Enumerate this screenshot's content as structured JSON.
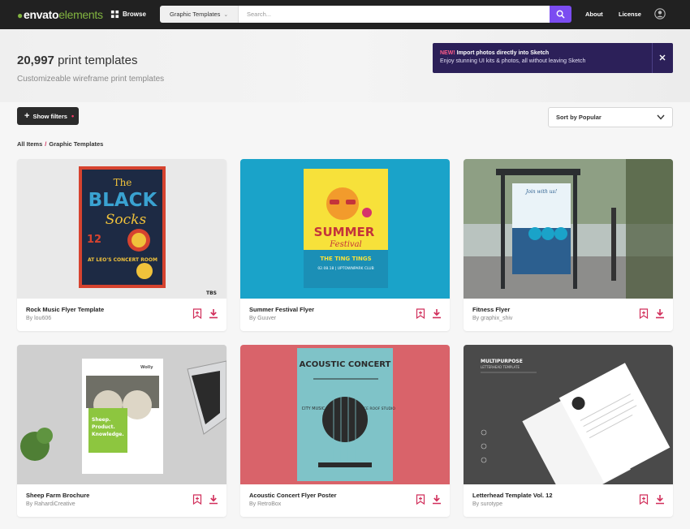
{
  "brand": {
    "logo_main": "envato",
    "logo_accent": "elements"
  },
  "nav": {
    "browse_label": "Browse",
    "category_select": "Graphic Templates",
    "search_placeholder": "Search...",
    "about_label": "About",
    "license_label": "License"
  },
  "header": {
    "count": "20,997",
    "title_suffix": "print templates",
    "subtitle": "Customizeable wireframe print templates"
  },
  "promo": {
    "badge": "NEW!",
    "headline": "Import photos directly into Sketch",
    "body": "Enjoy stunning UI kits & photos, all without leaving Sketch"
  },
  "filters": {
    "show_filters_label": "Show filters",
    "sort_label": "Sort by Popular"
  },
  "breadcrumb": {
    "root": "All Items",
    "current": "Graphic Templates"
  },
  "items": [
    {
      "title": "Rock Music Flyer Template",
      "author": "By lou606"
    },
    {
      "title": "Summer Festival Flyer",
      "author": "By Guuver"
    },
    {
      "title": "Fitness Flyer",
      "author": "By graphix_shiv"
    },
    {
      "title": "Sheep Farm Brochure",
      "author": "By RahardiCreative"
    },
    {
      "title": "Acoustic Concert Flyer Poster",
      "author": "By RetroBox"
    },
    {
      "title": "Letterhead Template Vol. 12",
      "author": "By surotype"
    }
  ],
  "thumb_text": {
    "rock_1": "The",
    "rock_2": "BLACK",
    "rock_3": "Socks",
    "rock_4": "12",
    "rock_5": "AT LEO'S CONCERT ROOM",
    "rock_corner": "TBS",
    "summer_1": "SUMMER",
    "summer_2": "Festival",
    "summer_3": "THE TING TINGS",
    "summer_4": "02.08.18 | UPTOWNPARK CLUB",
    "fitness_1": "Join with us!",
    "sheep_brand": "Wolly",
    "sheep_1": "Sheep.",
    "sheep_2": "Product.",
    "sheep_3": "Knowledge.",
    "acoustic_1": "ACOUSTIC CONCERT",
    "acoustic_2": "CITY MUSIC",
    "acoustic_3": "ALICE ROOF STUDIO",
    "letter_1": "MULTIPURPOSE",
    "letter_2": "LETTERHEAD TEMPLATE"
  },
  "colors": {
    "accent_purple": "#7b4cf1",
    "accent_pink": "#d12f5b",
    "brand_green": "#82b440",
    "topbar": "#212121",
    "promo_bg": "#2c2059"
  }
}
